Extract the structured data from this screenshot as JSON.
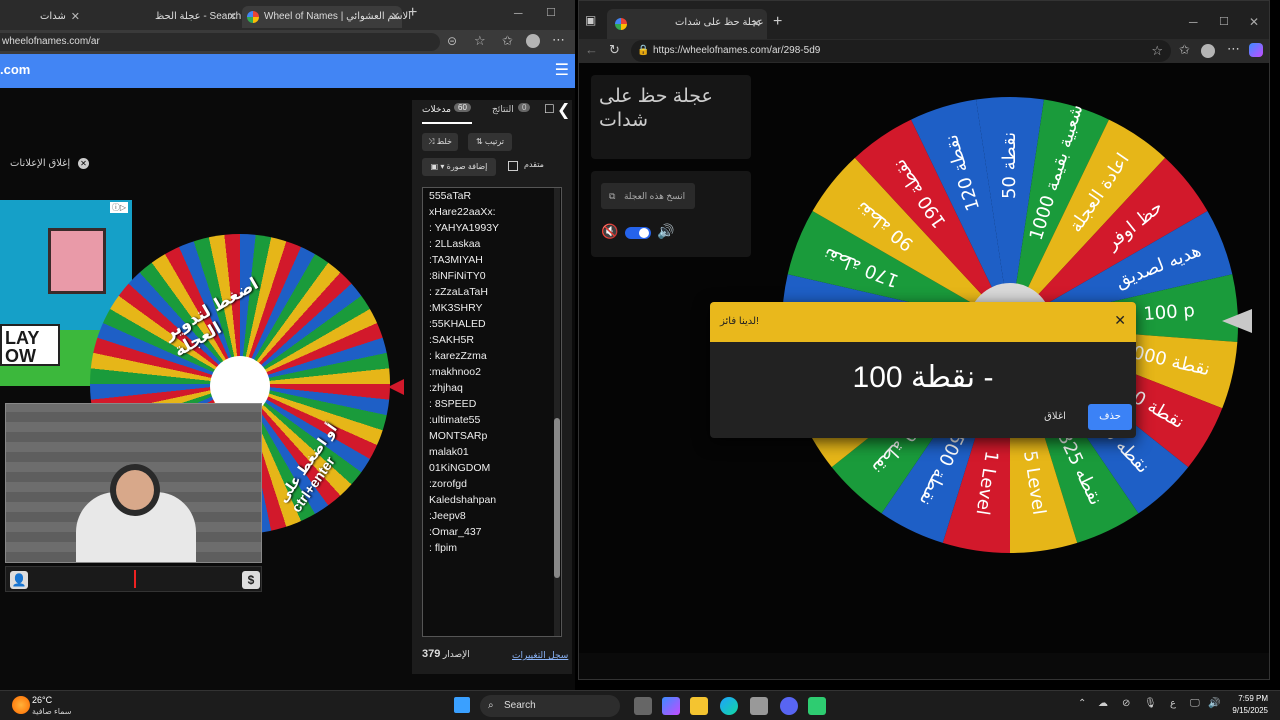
{
  "left_browser": {
    "tabs": [
      {
        "label": "شدات"
      },
      {
        "label": "عجلة الحظ - Search"
      },
      {
        "label": "Wheel of Names | الاسم العشوائي"
      }
    ],
    "url": "wheelofnames.com/ar",
    "brand": ".com",
    "close_ads_label": "إغلاق الإعلانات",
    "ad_text": "LAY\nOW",
    "spin_hint": "اضغط لتدوير العجلة",
    "spin_hint2": "أو اضغط على ctrl+enter",
    "entries_tab_label": "مدخلات",
    "entries_count": "60",
    "results_tab_label": "النتائج",
    "results_count": "0",
    "shuffle_label": "خلط",
    "sort_label": "ترتيب",
    "add_image_label": "إضافة صورة",
    "advanced_label": "متقدم",
    "entries": [
      "555aTaR",
      "xHare22aaXx:",
      ": YAHYA1993Y",
      ": 2LLaskaa",
      ":TA3MIYAH",
      ":8iNFiNiTY0",
      ": zZzaLaTaH",
      ":MK3SHRY",
      ":55KHALED",
      ":SAKH5R",
      ": karezZzma",
      ":makhnoo2",
      ":zhjhaq",
      ": 8SPEED",
      ":ultimate55",
      "MONTSARp",
      "malak01",
      "01KiNGDOM",
      ":zorofgd",
      "Kaledshahpan",
      ":Jeepv8",
      ":Omar_437",
      ": flpim"
    ],
    "version_label": "الإصدار",
    "version_number": "379",
    "changelog_label": "سجل التغييرات"
  },
  "right_browser": {
    "tab_title": "عجلة حظ على شدات",
    "url": "https://wheelofnames.com/ar/298-5d9",
    "wheel_title": "عجلة حظ على شدات",
    "copy_button_label": "انسخ هذه العجلة",
    "wheel_segments": [
      "نقطة 50",
      "شعبية بقيمة 1000",
      "اعادة العجلة",
      "حظ اوفر",
      "هديه لصديق",
      "100 p",
      "نقطة 1000",
      "100 نقطة",
      "700 نقطه",
      "325 نقطه",
      "5 Level",
      "1 Level",
      "500 نقطة",
      "200 نقطة",
      "50 نقطة",
      "20 نقطة",
      "50 نقطة",
      "170 نقطة",
      "90 نقطة",
      "190 نقطة",
      "120 نقطة"
    ],
    "wheel_colors": [
      "#1e5fc6",
      "#1a9b3b",
      "#e6b618",
      "#d2192b"
    ],
    "dialog": {
      "header": "لدينا فائز!",
      "winner": "نقطة 100 -",
      "remove_label": "حذف",
      "close_label": "اغلاق"
    }
  },
  "taskbar": {
    "temperature": "26°C",
    "weather": "سماء صافية",
    "search_label": "Search",
    "language": "ع",
    "time": "7:59 PM",
    "date": "9/15/2025"
  }
}
